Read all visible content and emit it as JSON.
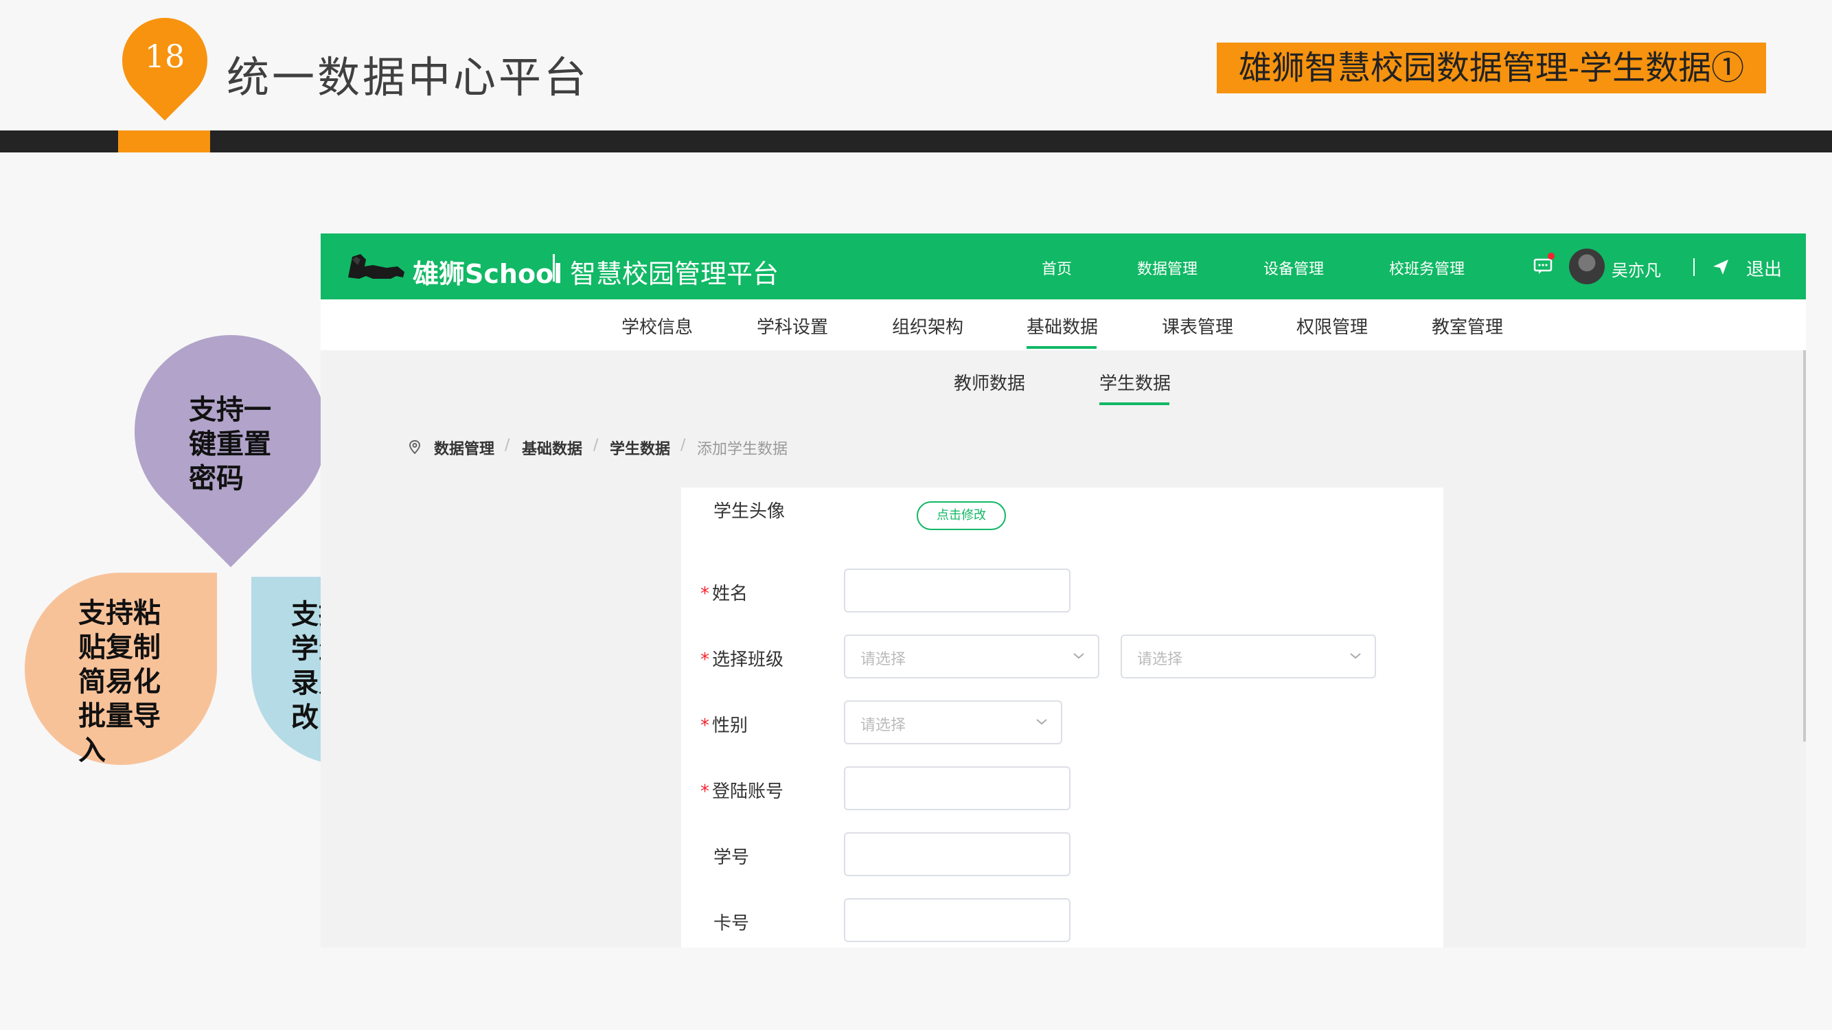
{
  "slide": {
    "page_number": "18",
    "title": "统一数据中心平台",
    "badge": "雄狮智慧校园数据管理-学生数据①",
    "accent_color": "#f7930f"
  },
  "callouts": {
    "reset_password": [
      "支持一",
      "键重置",
      "密码"
    ],
    "batch_import": [
      "支持粘",
      "贴复制",
      "简易化",
      "批量导",
      "入"
    ],
    "single_entry": [
      "支持单个",
      "学生信息",
      "录入，修",
      "改，删除"
    ]
  },
  "app": {
    "brand_color": "#11b865",
    "logo_text": "雄狮School",
    "platform_name": "智慧校园管理平台",
    "top_nav": [
      "首页",
      "数据管理",
      "设备管理",
      "校班务管理"
    ],
    "user_name": "吴亦凡",
    "logout_label": "退出",
    "sub_nav": [
      "学校信息",
      "学科设置",
      "组织架构",
      "基础数据",
      "课表管理",
      "权限管理",
      "教室管理"
    ],
    "sub_nav_active": "基础数据",
    "tabs": [
      "教师数据",
      "学生数据"
    ],
    "tab_active": "学生数据",
    "breadcrumb": [
      "数据管理",
      "基础数据",
      "学生数据",
      "添加学生数据"
    ],
    "form": {
      "avatar_label": "学生头像",
      "avatar_button": "点击修改",
      "name_label": "姓名",
      "class_label": "选择班级",
      "select_placeholder": "请选择",
      "gender_label": "性别",
      "account_label": "登陆账号",
      "student_no_label": "学号",
      "card_no_label": "卡号",
      "required_mark": "*"
    }
  }
}
